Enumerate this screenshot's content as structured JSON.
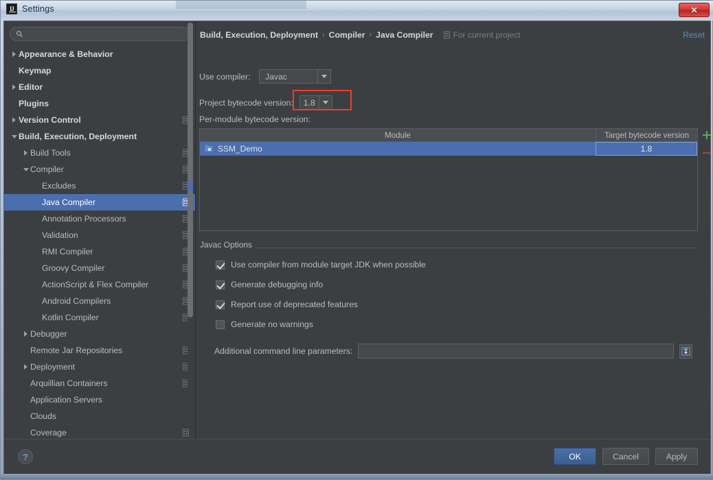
{
  "window": {
    "title": "Settings",
    "app_icon": "intellij-idea-logo",
    "close_label": "✕"
  },
  "sidebar": {
    "search": {
      "value": "",
      "placeholder": "",
      "icon": "search-icon"
    },
    "items": [
      {
        "label": "Appearance & Behavior",
        "indent": 0,
        "twisty": "collapsed",
        "bold": true,
        "project_icon": false,
        "selected": false
      },
      {
        "label": "Keymap",
        "indent": 0,
        "twisty": "none",
        "bold": true,
        "project_icon": false,
        "selected": false
      },
      {
        "label": "Editor",
        "indent": 0,
        "twisty": "collapsed",
        "bold": true,
        "project_icon": false,
        "selected": false
      },
      {
        "label": "Plugins",
        "indent": 0,
        "twisty": "none",
        "bold": true,
        "project_icon": false,
        "selected": false
      },
      {
        "label": "Version Control",
        "indent": 0,
        "twisty": "collapsed",
        "bold": true,
        "project_icon": true,
        "selected": false
      },
      {
        "label": "Build, Execution, Deployment",
        "indent": 0,
        "twisty": "expanded",
        "bold": true,
        "project_icon": false,
        "selected": false
      },
      {
        "label": "Build Tools",
        "indent": 1,
        "twisty": "collapsed",
        "bold": false,
        "project_icon": true,
        "selected": false
      },
      {
        "label": "Compiler",
        "indent": 1,
        "twisty": "expanded",
        "bold": false,
        "project_icon": true,
        "selected": false
      },
      {
        "label": "Excludes",
        "indent": 2,
        "twisty": "none",
        "bold": false,
        "project_icon": true,
        "selected": false
      },
      {
        "label": "Java Compiler",
        "indent": 2,
        "twisty": "none",
        "bold": false,
        "project_icon": true,
        "selected": true
      },
      {
        "label": "Annotation Processors",
        "indent": 2,
        "twisty": "none",
        "bold": false,
        "project_icon": true,
        "selected": false
      },
      {
        "label": "Validation",
        "indent": 2,
        "twisty": "none",
        "bold": false,
        "project_icon": true,
        "selected": false
      },
      {
        "label": "RMI Compiler",
        "indent": 2,
        "twisty": "none",
        "bold": false,
        "project_icon": true,
        "selected": false
      },
      {
        "label": "Groovy Compiler",
        "indent": 2,
        "twisty": "none",
        "bold": false,
        "project_icon": true,
        "selected": false
      },
      {
        "label": "ActionScript & Flex Compiler",
        "indent": 2,
        "twisty": "none",
        "bold": false,
        "project_icon": true,
        "selected": false
      },
      {
        "label": "Android Compilers",
        "indent": 2,
        "twisty": "none",
        "bold": false,
        "project_icon": true,
        "selected": false
      },
      {
        "label": "Kotlin Compiler",
        "indent": 2,
        "twisty": "none",
        "bold": false,
        "project_icon": true,
        "selected": false
      },
      {
        "label": "Debugger",
        "indent": 1,
        "twisty": "collapsed",
        "bold": false,
        "project_icon": false,
        "selected": false
      },
      {
        "label": "Remote Jar Repositories",
        "indent": 1,
        "twisty": "none",
        "bold": false,
        "project_icon": true,
        "selected": false
      },
      {
        "label": "Deployment",
        "indent": 1,
        "twisty": "collapsed",
        "bold": false,
        "project_icon": true,
        "selected": false
      },
      {
        "label": "Arquillian Containers",
        "indent": 1,
        "twisty": "none",
        "bold": false,
        "project_icon": true,
        "selected": false
      },
      {
        "label": "Application Servers",
        "indent": 1,
        "twisty": "none",
        "bold": false,
        "project_icon": false,
        "selected": false
      },
      {
        "label": "Clouds",
        "indent": 1,
        "twisty": "none",
        "bold": false,
        "project_icon": false,
        "selected": false
      },
      {
        "label": "Coverage",
        "indent": 1,
        "twisty": "none",
        "bold": false,
        "project_icon": true,
        "selected": false
      }
    ]
  },
  "main": {
    "breadcrumb": {
      "parts": [
        "Build, Execution, Deployment",
        "Compiler",
        "Java Compiler"
      ],
      "separator": "›",
      "scope_label": "For current project",
      "scope_icon": "project-scope-icon"
    },
    "reset_label": "Reset",
    "use_compiler": {
      "label": "Use compiler:",
      "value": "Javac"
    },
    "project_bytecode": {
      "label": "Project bytecode version:",
      "value": "1.8"
    },
    "per_module_label": "Per-module bytecode version:",
    "table": {
      "columns": [
        "Module",
        "Target bytecode version"
      ],
      "rows": [
        {
          "module": "SSM_Demo",
          "target": "1.8",
          "selected": true,
          "icon": "module-icon"
        }
      ],
      "add_label": "+",
      "remove_label": "−"
    },
    "javac_options": {
      "title": "Javac Options",
      "checkboxes": [
        {
          "label": "Use compiler from module target JDK when possible",
          "checked": true
        },
        {
          "label": "Generate debugging info",
          "checked": true
        },
        {
          "label": "Report use of deprecated features",
          "checked": true
        },
        {
          "label": "Generate no warnings",
          "checked": false
        }
      ],
      "additional_params": {
        "label": "Additional command line parameters:",
        "value": "",
        "placeholder": "",
        "expand_icon": "expand-field-icon"
      }
    }
  },
  "footer": {
    "help_label": "?",
    "buttons": [
      {
        "label": "OK",
        "style": "primary"
      },
      {
        "label": "Cancel",
        "style": "normal"
      },
      {
        "label": "Apply",
        "style": "normal"
      }
    ]
  },
  "highlight_color": "#f03c2e"
}
